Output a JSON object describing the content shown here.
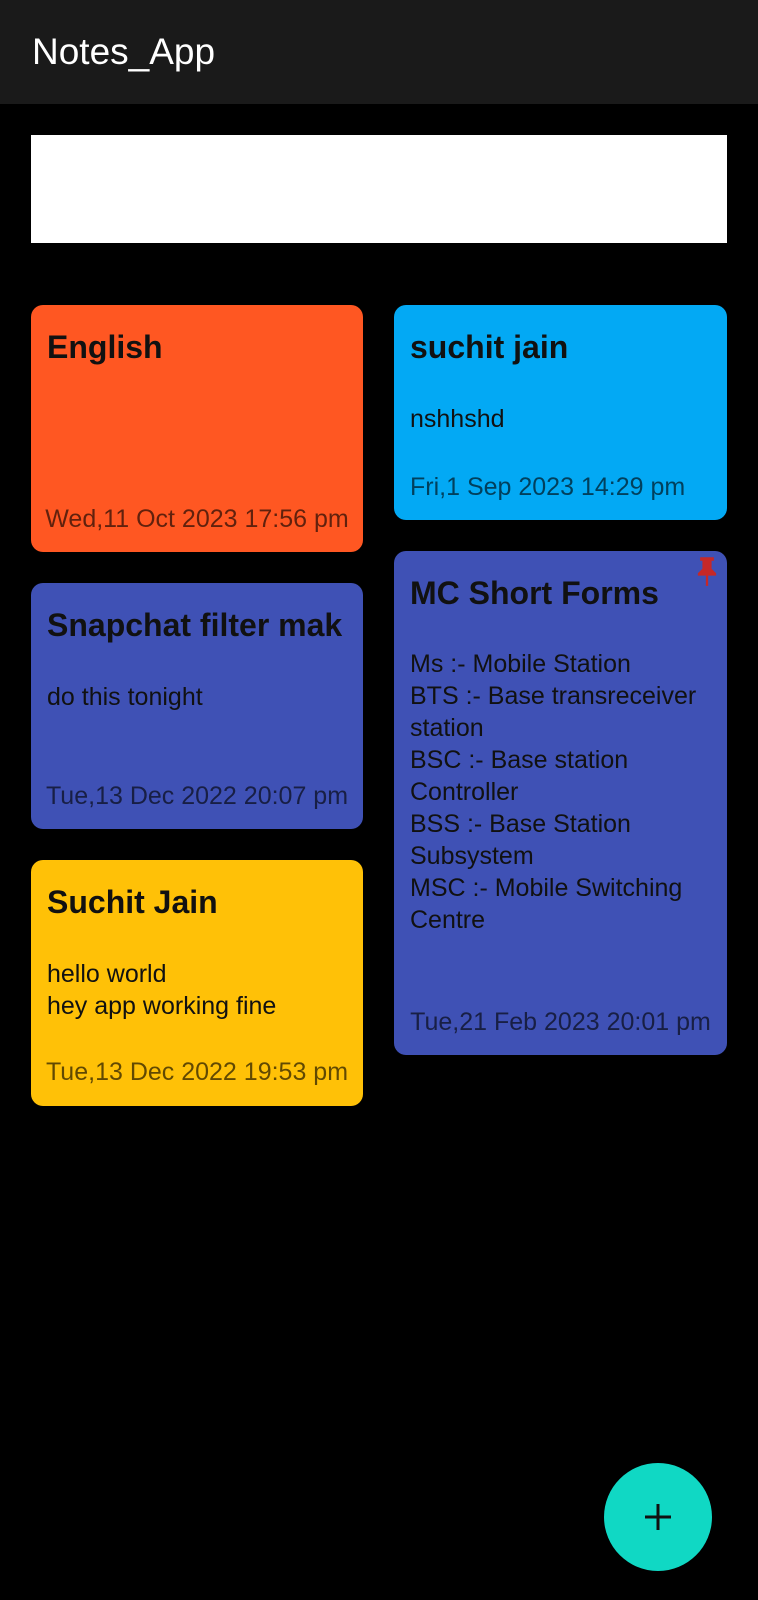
{
  "app": {
    "title": "Notes_App"
  },
  "search": {
    "value": "",
    "placeholder": ""
  },
  "notes": [
    {
      "title": "English",
      "body": "",
      "date": "Wed,11 Oct 2023 17:56 pm",
      "color": "#ff5722",
      "pinned": false
    },
    {
      "title": "suchit jain",
      "body": "nshhshd",
      "date": "Fri,1 Sep 2023 14:29 pm",
      "color": "#03a9f4",
      "pinned": false
    },
    {
      "title": "Snapchat filter mak",
      "body": "do this tonight",
      "date": "Tue,13 Dec 2022 20:07 pm",
      "color": "#3f51b5",
      "pinned": false
    },
    {
      "title": "MC Short Forms",
      "body": "Ms :- Mobile Station\nBTS :- Base transreceiver\nstation\nBSC :- Base station\nController\nBSS :- Base Station\nSubsystem\nMSC :- Mobile Switching\nCentre",
      "date": "Tue,21 Feb 2023 20:01 pm",
      "color": "#3f51b5",
      "pinned": true
    },
    {
      "title": "Suchit Jain",
      "body": "hello world\nhey app working fine",
      "date": "Tue,13 Dec 2022 19:53 pm",
      "color": "#ffc107",
      "pinned": false
    }
  ],
  "fab": {
    "icon": "plus-icon",
    "color": "#10d8c4"
  },
  "colors": {
    "background": "#000000",
    "appbar": "#1a1a1a",
    "pin": "#c62828"
  }
}
